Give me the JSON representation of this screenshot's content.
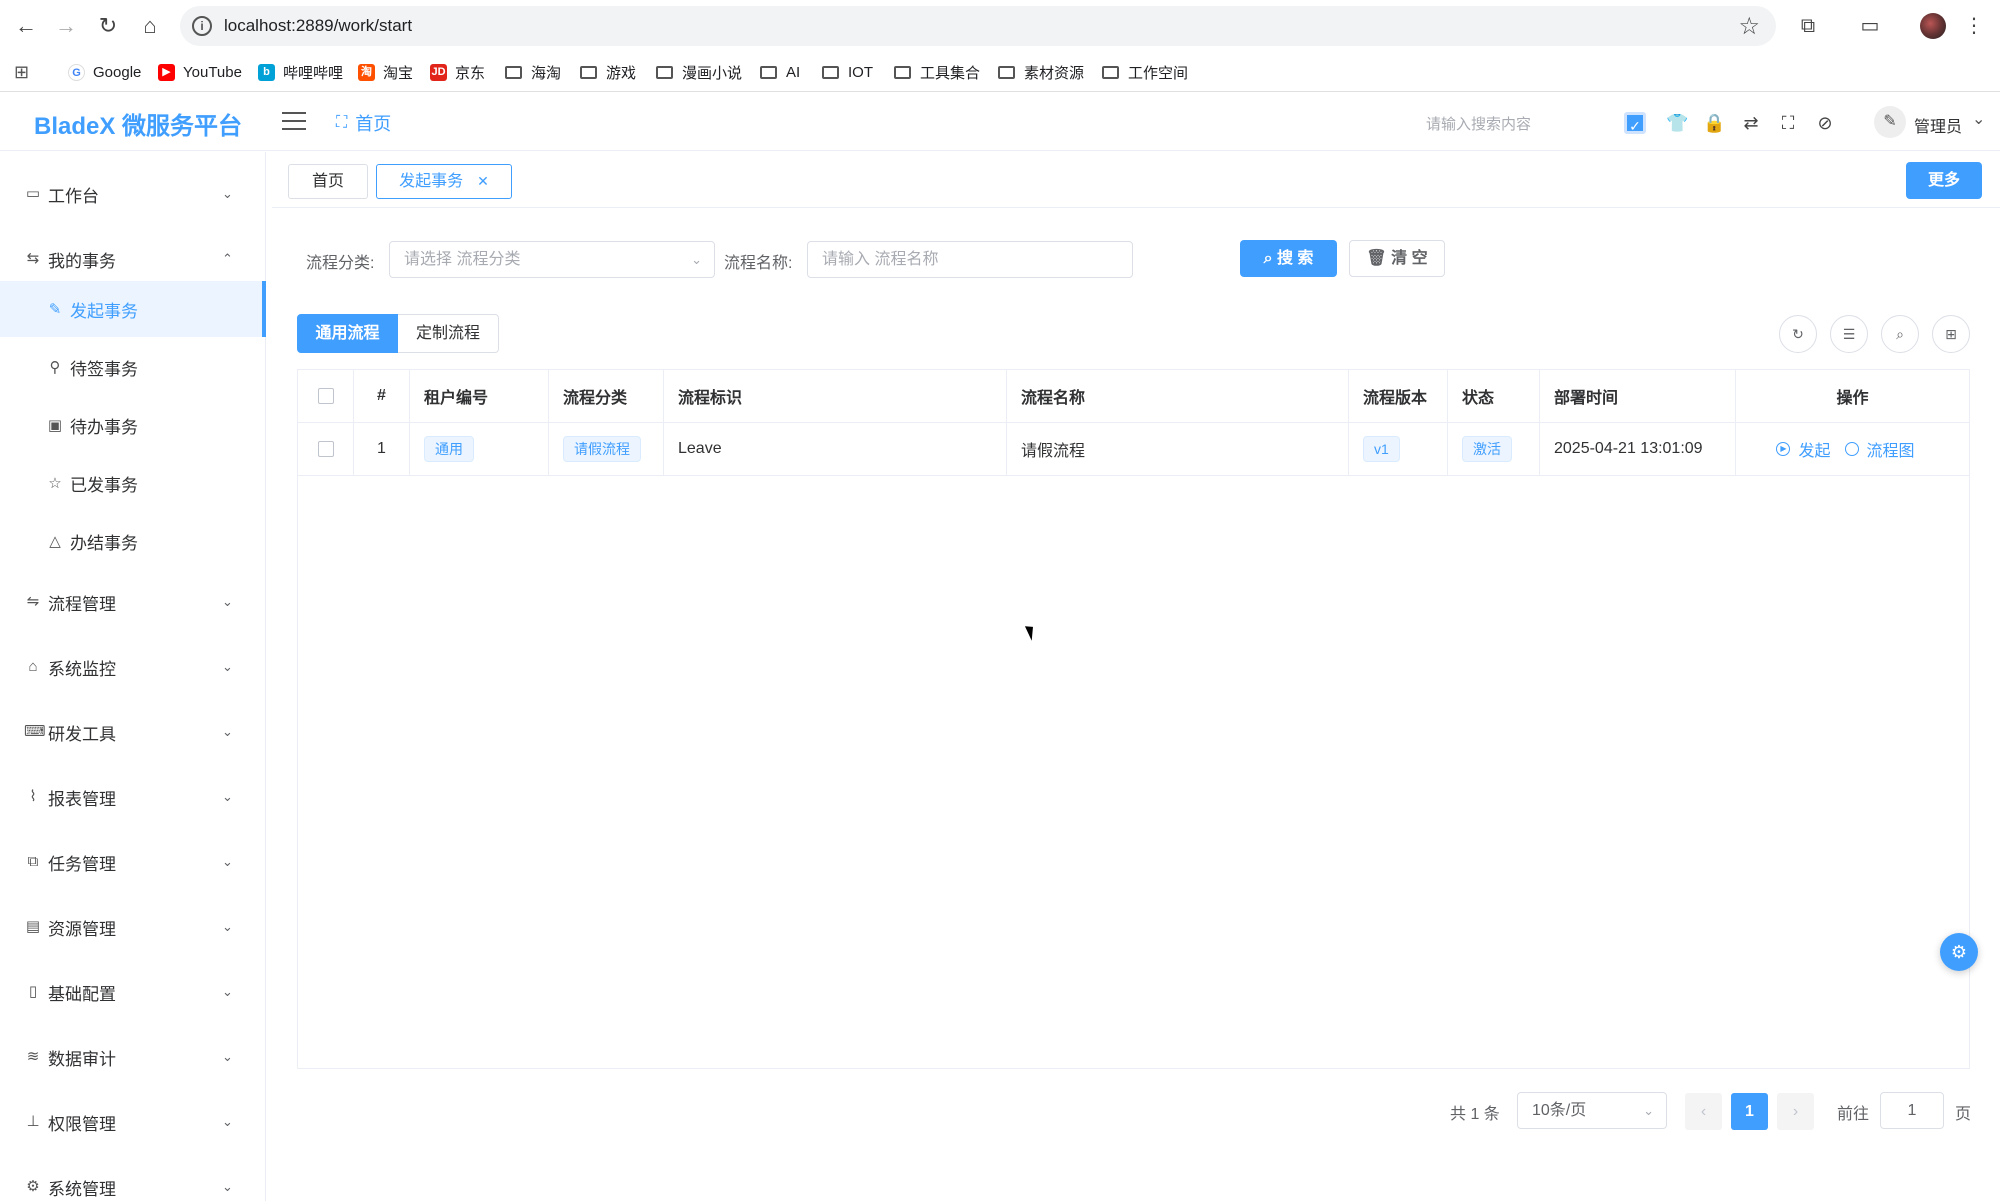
{
  "browser": {
    "url": "localhost:2889/work/start",
    "bookmarks": [
      "Google",
      "YouTube",
      "哔哩哔哩",
      "淘宝",
      "京东",
      "海淘",
      "游戏",
      "漫画小说",
      "AI",
      "IOT",
      "工具集合",
      "素材资源",
      "工作空间"
    ]
  },
  "header": {
    "logo": "BladeX 微服务平台",
    "breadcrumb": "首页",
    "search_placeholder": "请输入搜索内容",
    "user": "管理员"
  },
  "sidebar": {
    "items": [
      {
        "label": "工作台",
        "icon": "monitor-icon",
        "expanded": false
      },
      {
        "label": "我的事务",
        "icon": "tasks-icon",
        "expanded": true
      },
      {
        "label": "流程管理",
        "icon": "flow-icon",
        "expanded": false
      },
      {
        "label": "系统监控",
        "icon": "monitor-bank-icon",
        "expanded": false
      },
      {
        "label": "研发工具",
        "icon": "code-icon",
        "expanded": false
      },
      {
        "label": "报表管理",
        "icon": "chart-icon",
        "expanded": false
      },
      {
        "label": "任务管理",
        "icon": "task-icon",
        "expanded": false
      },
      {
        "label": "资源管理",
        "icon": "resource-icon",
        "expanded": false
      },
      {
        "label": "基础配置",
        "icon": "book-icon",
        "expanded": false
      },
      {
        "label": "数据审计",
        "icon": "layers-icon",
        "expanded": false
      },
      {
        "label": "权限管理",
        "icon": "stamp-icon",
        "expanded": false
      },
      {
        "label": "系统管理",
        "icon": "gear-icon",
        "expanded": false
      }
    ],
    "subitems": [
      {
        "label": "发起事务",
        "icon": "edit-icon",
        "active": true
      },
      {
        "label": "待签事务",
        "icon": "pin-icon",
        "active": false
      },
      {
        "label": "待办事务",
        "icon": "calendar-icon",
        "active": false
      },
      {
        "label": "已发事务",
        "icon": "star-icon",
        "active": false
      },
      {
        "label": "办结事务",
        "icon": "warning-icon",
        "active": false
      }
    ]
  },
  "tags": {
    "home": "首页",
    "current": "发起事务",
    "more": "更多"
  },
  "form": {
    "category_label": "流程分类:",
    "category_placeholder": "请选择 流程分类",
    "name_label": "流程名称:",
    "name_placeholder": "请输入 流程名称",
    "search_btn": "搜 索",
    "clear_btn": "清 空"
  },
  "segments": {
    "general": "通用流程",
    "custom": "定制流程"
  },
  "table": {
    "headers": [
      "#",
      "租户编号",
      "流程分类",
      "流程标识",
      "流程名称",
      "流程版本",
      "状态",
      "部署时间",
      "操作"
    ],
    "rows": [
      {
        "index": "1",
        "tenant": "通用",
        "category": "请假流程",
        "key": "Leave",
        "name": "请假流程",
        "version": "v1",
        "status": "激活",
        "deploy_time": "2025-04-21 13:01:09",
        "action_start": "发起",
        "action_diagram": "流程图"
      }
    ]
  },
  "pagination": {
    "total": "共 1 条",
    "page_size": "10条/页",
    "current_page": "1",
    "goto_label": "前往",
    "goto_value": "1",
    "page_suffix": "页"
  },
  "colors": {
    "primary": "#409eff",
    "border": "#dcdfe6"
  }
}
